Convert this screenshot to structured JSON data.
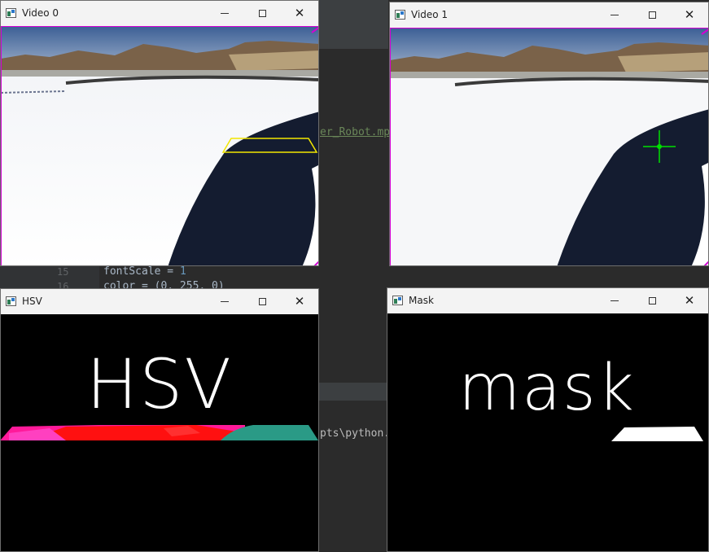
{
  "ide": {
    "link_text": "er_Robot.mp",
    "line_number_15": "15",
    "line_number_16": "16",
    "code_line_15_name": "fontScale",
    "code_line_15_op": " = ",
    "code_line_15_value": "1",
    "code_line_16": "color = (0, 255, 0)",
    "terminal_text": "pts\\python."
  },
  "windows": {
    "video0": {
      "title": "Video 0"
    },
    "video1": {
      "title": "Video 1"
    },
    "hsv": {
      "title": "HSV",
      "overlay": "HSV"
    },
    "mask": {
      "title": "Mask",
      "overlay": "mask"
    }
  },
  "colors": {
    "accent_magenta": "#d400d4",
    "roi_yellow": "#f2e600",
    "crosshair_green": "#00e000"
  }
}
